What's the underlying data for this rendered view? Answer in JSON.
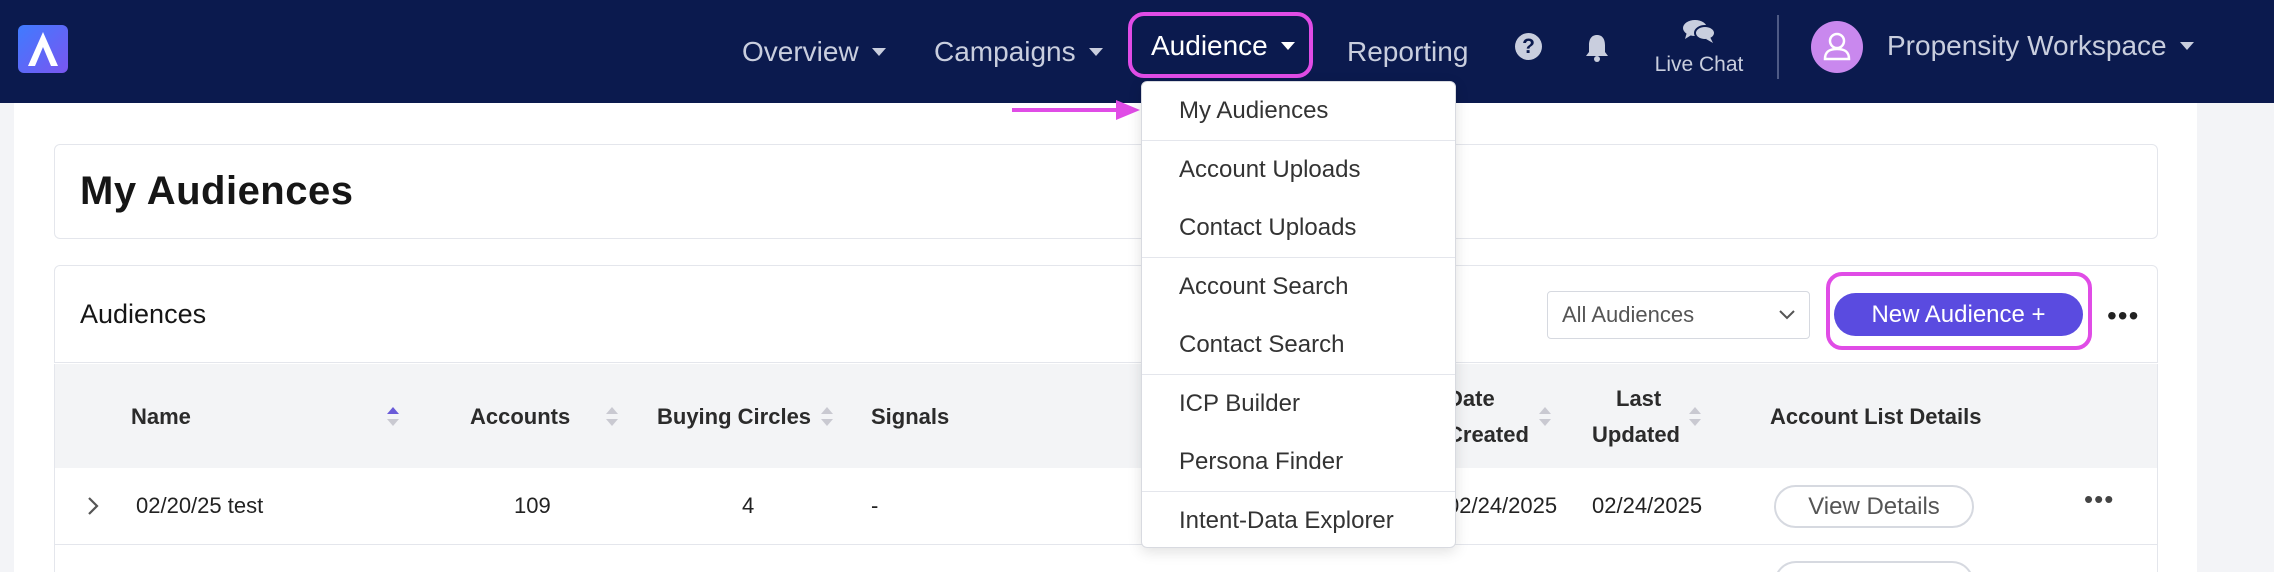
{
  "navbar": {
    "items": [
      {
        "label": "Overview",
        "has_caret": true
      },
      {
        "label": "Campaigns",
        "has_caret": true
      },
      {
        "label": "Audience",
        "has_caret": true,
        "active": true
      },
      {
        "label": "Reporting",
        "has_caret": false
      }
    ],
    "help_glyph": "?",
    "live_chat_label": "Live Chat",
    "workspace_label": "Propensity Workspace",
    "background_color": "#0b1a4e",
    "highlight_color": "#e04ce6"
  },
  "audience_menu": {
    "items": [
      {
        "label": "My Audiences"
      },
      {
        "label": "Account Uploads"
      },
      {
        "label": "Contact Uploads"
      },
      {
        "label": "Account Search"
      },
      {
        "label": "Contact Search"
      },
      {
        "label": "ICP Builder"
      },
      {
        "label": "Persona Finder"
      },
      {
        "label": "Intent-Data Explorer"
      }
    ]
  },
  "page": {
    "title": "My Audiences"
  },
  "audiences": {
    "title": "Audiences",
    "filter_value": "All Audiences",
    "new_button_label": "New Audience +",
    "more_glyph": "•••",
    "columns": {
      "name": "Name",
      "accounts": "Accounts",
      "buying_circles": "Buying Circles",
      "signals": "Signals",
      "date_created_1": "Date",
      "date_created_2": "Created",
      "last_updated_1": "Last",
      "last_updated_2": "Updated",
      "details": "Account List Details"
    },
    "rows": [
      {
        "name": "02/20/25 test",
        "accounts": "109",
        "buying_circles": "4",
        "signals": "-",
        "date_created": "02/24/2025",
        "last_updated": "02/24/2025",
        "details_button": "View Details"
      }
    ]
  }
}
